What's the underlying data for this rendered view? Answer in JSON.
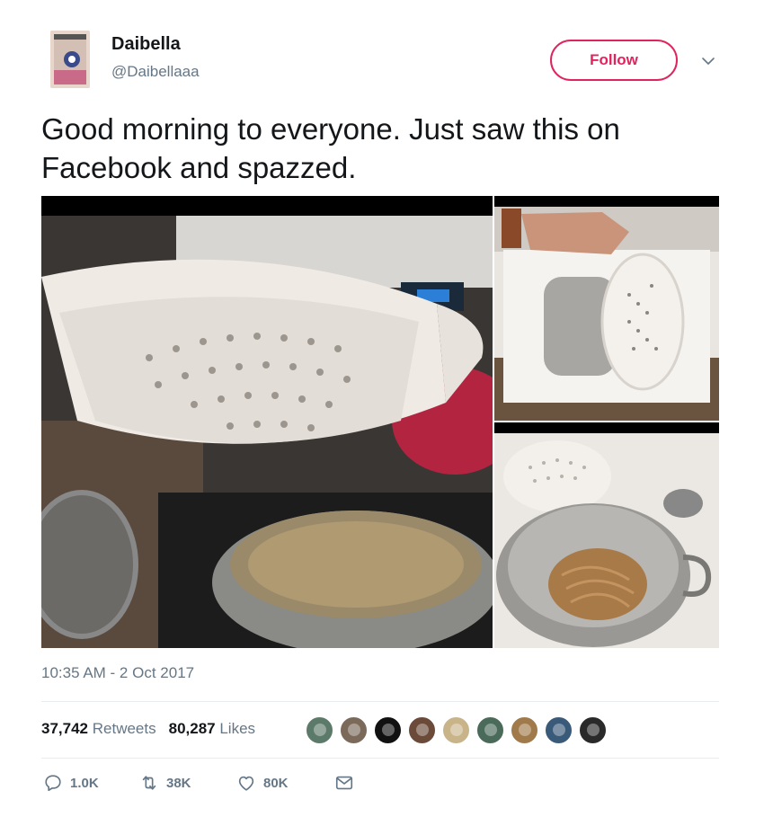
{
  "user": {
    "display_name": "Daibella",
    "handle": "@Daibellaaa",
    "avatar_icon": "profile-photo"
  },
  "follow_label": "Follow",
  "accent_color": "#e0245e",
  "tweet": {
    "text": "Good morning to everyone. Just saw this on Facebook and spazzed.",
    "timestamp": "10:35 AM - 2 Oct 2017"
  },
  "media": {
    "photos": [
      {
        "description_icon": "colander-over-pot-photo"
      },
      {
        "description_icon": "pot-in-sink-photo"
      },
      {
        "description_icon": "spaghetti-in-pot-photo"
      }
    ]
  },
  "stats": {
    "retweets_count": "37,742",
    "retweets_label": "Retweets",
    "likes_count": "80,287",
    "likes_label": "Likes"
  },
  "likers": [
    {
      "color": "#5b7a6a"
    },
    {
      "color": "#7b6a5a"
    },
    {
      "color": "#111111"
    },
    {
      "color": "#6b4a3a"
    },
    {
      "color": "#c9b48a"
    },
    {
      "color": "#4a6a5a"
    },
    {
      "color": "#a07a4a"
    },
    {
      "color": "#3a5a7a"
    },
    {
      "color": "#2a2a2a"
    }
  ],
  "actions": {
    "reply": {
      "icon": "reply-icon",
      "count": "1.0K"
    },
    "retweet": {
      "icon": "retweet-icon",
      "count": "38K"
    },
    "like": {
      "icon": "heart-icon",
      "count": "80K"
    },
    "message": {
      "icon": "envelope-icon"
    }
  }
}
